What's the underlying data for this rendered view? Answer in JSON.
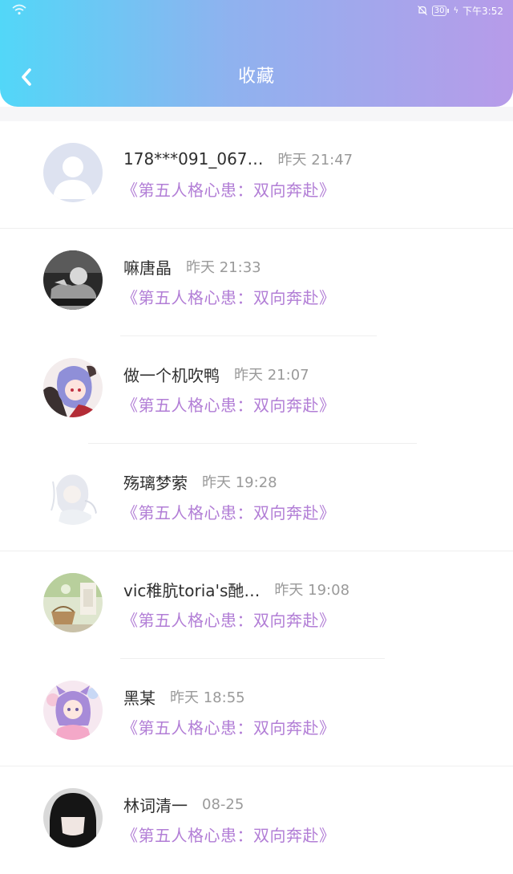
{
  "status_bar": {
    "time": "下午3:52",
    "battery": "30"
  },
  "header": {
    "title": "收藏",
    "back_icon": "chevron-left-icon"
  },
  "colors": {
    "header_gradient": [
      "#52d7f8",
      "#8fb2ef",
      "#b79be9"
    ],
    "collection_title": "#b27ed6",
    "timestamp": "#9a9a9a"
  },
  "items": [
    {
      "name": "178***091_067…",
      "time": "昨天 21:47",
      "title": "《第五人格心患：双向奔赴》"
    },
    {
      "name": "嘛唐晶",
      "time": "昨天 21:33",
      "title": "《第五人格心患：双向奔赴》"
    },
    {
      "name": "做一个机吹鸭",
      "time": "昨天 21:07",
      "title": "《第五人格心患：双向奔赴》"
    },
    {
      "name": "殇璃梦萦",
      "time": "昨天 19:28",
      "title": "《第五人格心患：双向奔赴》"
    },
    {
      "name": "vic稚肮toria's酏…",
      "time": "昨天 19:08",
      "title": "《第五人格心患：双向奔赴》"
    },
    {
      "name": "黑某",
      "time": "昨天 18:55",
      "title": "《第五人格心患：双向奔赴》"
    },
    {
      "name": "林词清一",
      "time": "08-25",
      "title": "《第五人格心患：双向奔赴》"
    }
  ]
}
